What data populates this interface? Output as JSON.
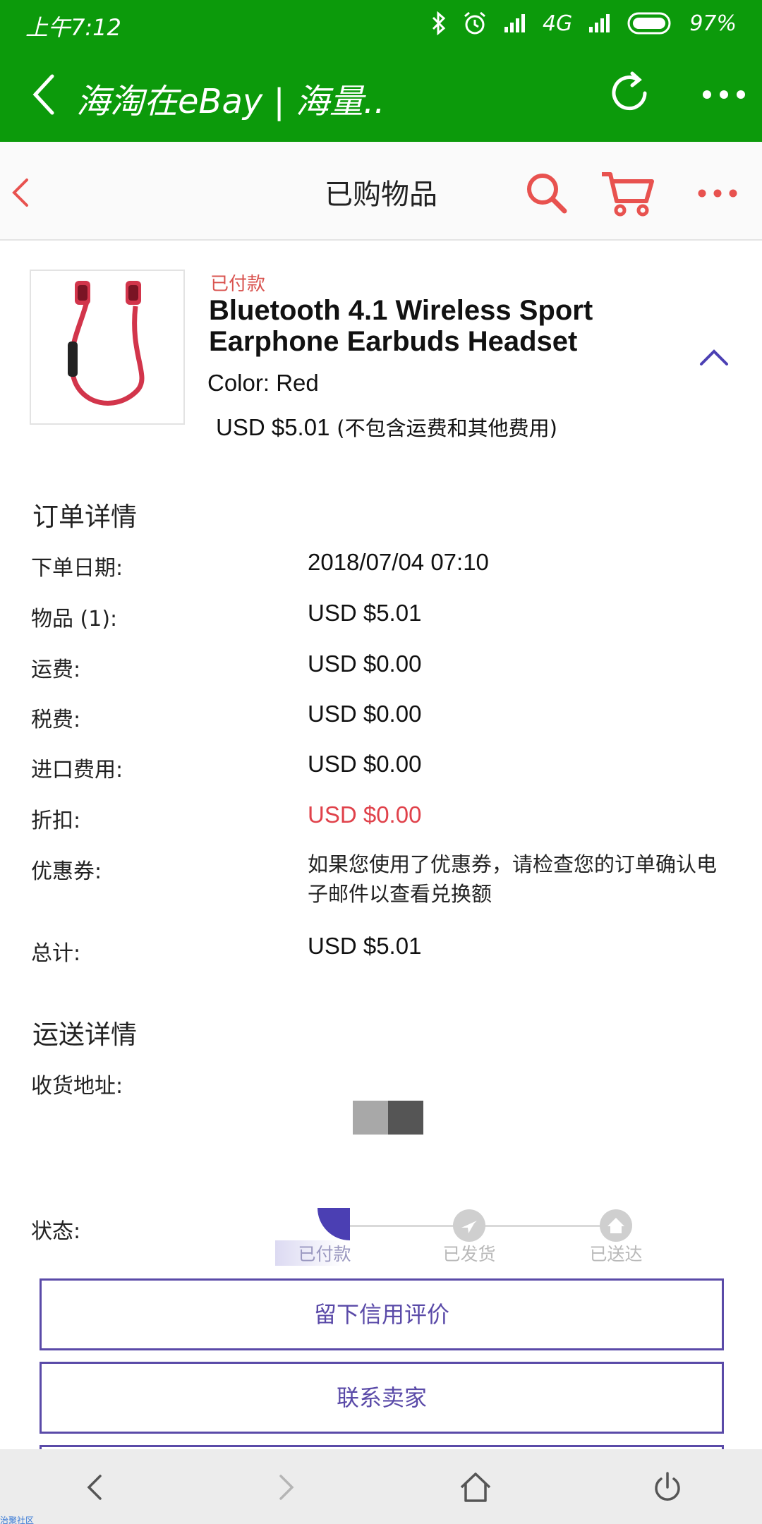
{
  "status_bar": {
    "time": "上午7:12",
    "network": "4G",
    "battery": "97%"
  },
  "browser": {
    "title": "海淘在eBay | 海量..",
    "back_icon": "back-chevron-icon",
    "refresh_icon": "refresh-icon",
    "more_icon": "more-dots-icon"
  },
  "header": {
    "title": "已购物品",
    "accent_color": "#e8524f"
  },
  "item": {
    "status": "已付款",
    "title": "Bluetooth 4.1 Wireless Sport Earphone Earbuds Headset",
    "color": "Color: Red",
    "price": "USD $5.01",
    "price_note": "(不包含运费和其他费用)"
  },
  "order": {
    "section_title": "订单详情",
    "rows": [
      {
        "label": "下单日期:",
        "value": "2018/07/04 07:10"
      },
      {
        "label": "物品 (1):",
        "value": "USD $5.01"
      },
      {
        "label": "运费:",
        "value": "USD $0.00"
      },
      {
        "label": "税费:",
        "value": "USD $0.00"
      },
      {
        "label": "进口费用:",
        "value": "USD $0.00"
      },
      {
        "label": "折扣:",
        "value": "USD $0.00"
      },
      {
        "label": "优惠券:",
        "value": "如果您使用了优惠券，请检查您的订单确认电子邮件以查看兑换额"
      },
      {
        "label": "总计:",
        "value": "USD $5.01"
      }
    ]
  },
  "shipping": {
    "section_title": "运送详情",
    "address_label": "收货地址:",
    "status_label": "状态:",
    "steps": [
      {
        "label": "已付款",
        "icon": "paid-icon",
        "active": true
      },
      {
        "label": "已发货",
        "icon": "plane-icon",
        "active": false
      },
      {
        "label": "已送达",
        "icon": "home-icon",
        "active": false
      }
    ]
  },
  "actions": {
    "feedback": "留下信用评价",
    "contact": "联系卖家"
  },
  "corner_text": "治聚社区"
}
